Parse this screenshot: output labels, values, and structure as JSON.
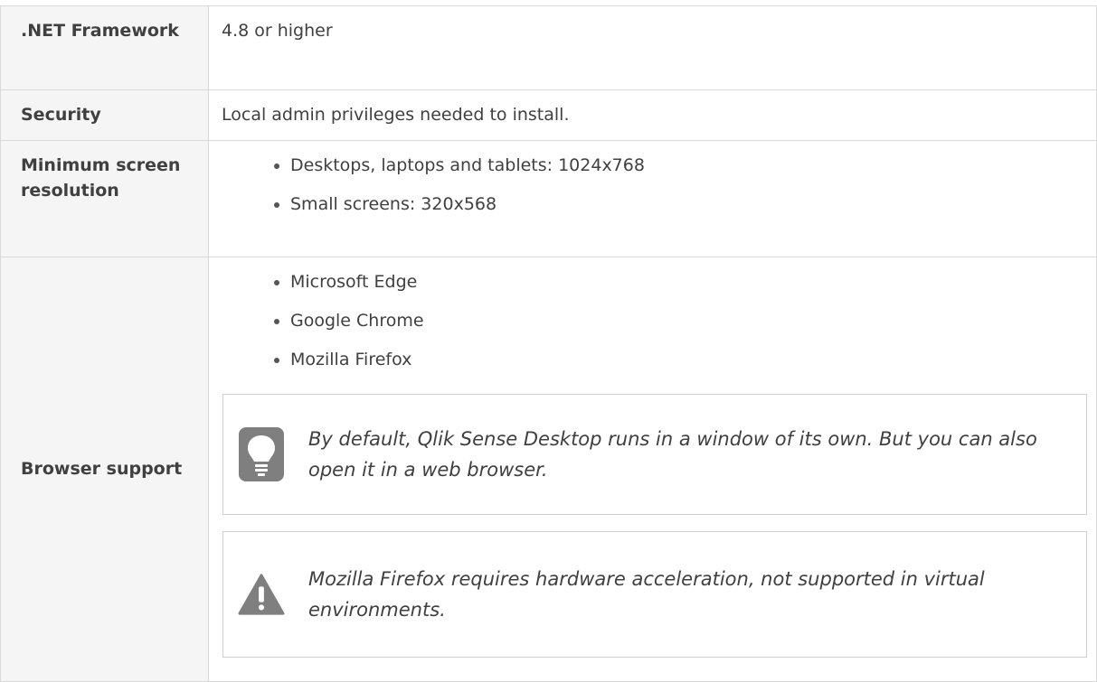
{
  "rows": [
    {
      "label": ".NET Framework",
      "value": "4.8 or higher"
    },
    {
      "label": "Security",
      "value": "Local admin privileges needed to install."
    },
    {
      "label": "Minimum screen resolution",
      "items": [
        "Desktops, laptops and tablets: 1024x768",
        "Small screens: 320x568"
      ]
    },
    {
      "label": "Browser support",
      "items": [
        "Microsoft Edge",
        "Google Chrome",
        "Mozilla Firefox"
      ],
      "tip": {
        "icon": "lightbulb-icon",
        "text": "By default, Qlik Sense Desktop runs in a window of its own. But you can also open it in a web browser."
      },
      "warning": {
        "icon": "warning-icon",
        "text": "Mozilla Firefox requires hardware acceleration, not supported in virtual environments."
      }
    }
  ],
  "colors": {
    "border": "#d9d9d9",
    "label_bg": "#f5f5f5",
    "icon": "#7f7f7f"
  }
}
